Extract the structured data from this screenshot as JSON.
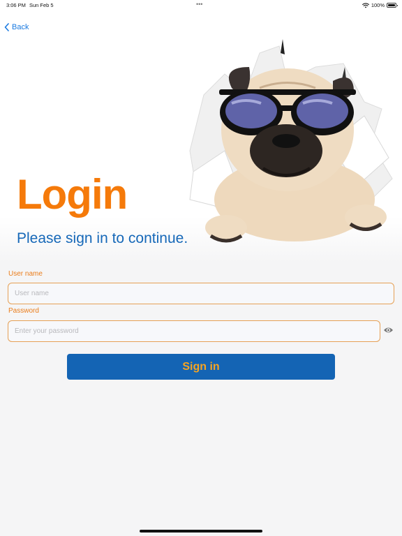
{
  "status_bar": {
    "time": "3:06 PM",
    "date": "Sun Feb 5",
    "dots": "•••",
    "battery_text": "100%"
  },
  "nav": {
    "back_label": "Back"
  },
  "hero": {
    "title": "Login",
    "subtitle": "Please sign in to continue."
  },
  "form": {
    "username_label": "User name",
    "username_placeholder": "User name",
    "username_value": "",
    "password_label": "Password",
    "password_placeholder": "Enter your password",
    "password_value": ""
  },
  "actions": {
    "signin_label": "Sign in"
  },
  "colors": {
    "accent_orange": "#f57a0a",
    "brand_blue": "#1464b4",
    "link_blue": "#1a7ae0",
    "button_text": "#f7a420"
  },
  "icons": [
    "chevron-left-icon",
    "wifi-icon",
    "battery-icon",
    "eye-icon",
    "pug-illustration"
  ]
}
